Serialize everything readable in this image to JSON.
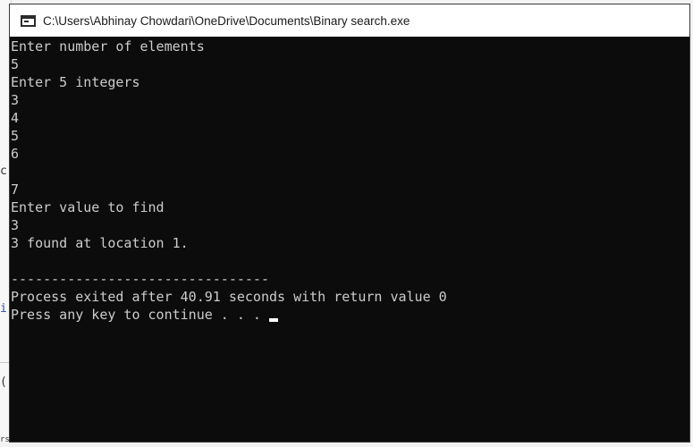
{
  "window": {
    "title": "C:\\Users\\Abhinay Chowdari\\OneDrive\\Documents\\Binary search.exe"
  },
  "console": {
    "lines": [
      "Enter number of elements",
      "5",
      "Enter 5 integers",
      "3",
      "4",
      "5",
      "6",
      "",
      "7",
      "Enter value to find",
      "3",
      "3 found at location 1.",
      "",
      "--------------------------------",
      "Process exited after 40.91 seconds with return value 0"
    ],
    "prompt_line": "Press any key to continue . . . "
  },
  "background": {
    "fragments": [
      "c",
      "i",
      "(",
      "rs"
    ]
  },
  "colors": {
    "console_bg": "#0c0c0c",
    "console_text": "#cccccc",
    "title_bar_bg": "#ffffff"
  }
}
